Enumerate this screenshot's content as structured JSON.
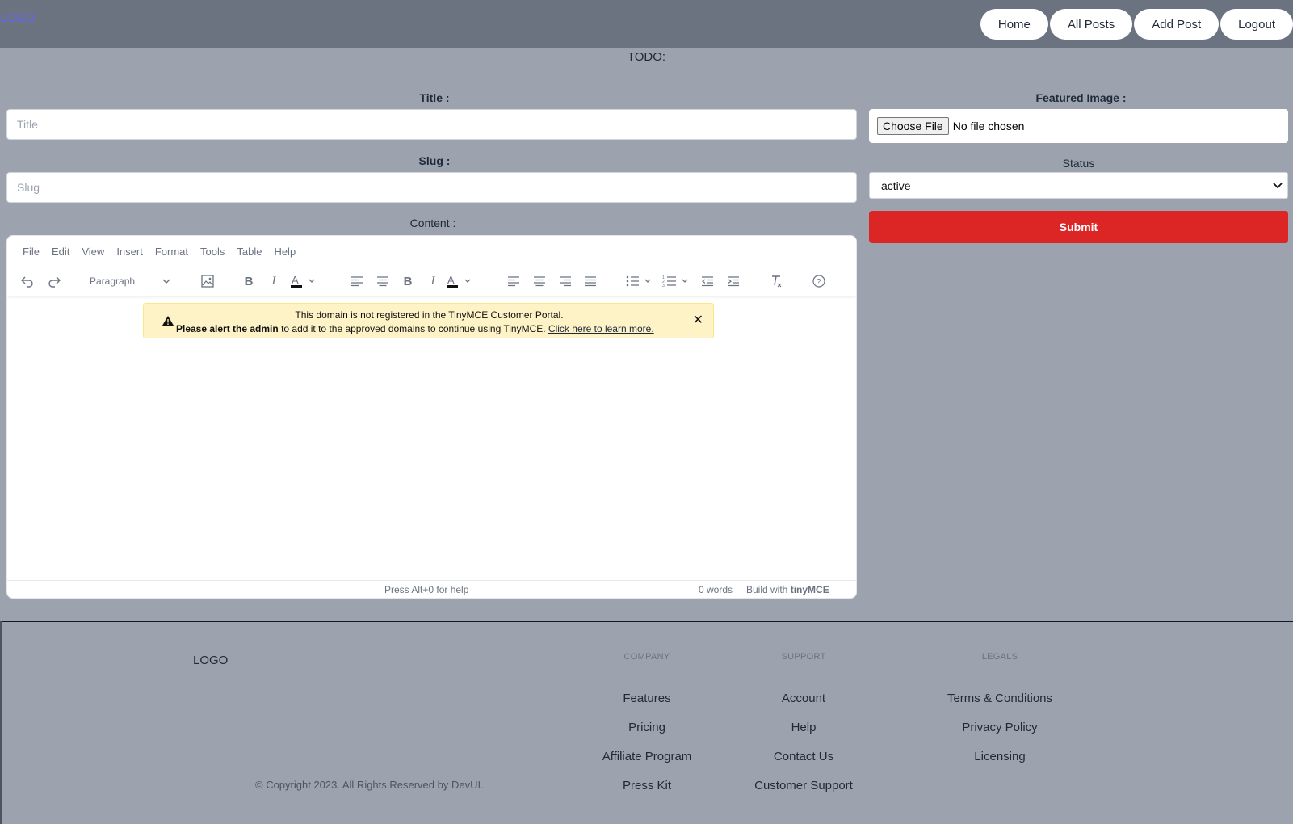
{
  "header": {
    "logo": "LOGO",
    "nav": [
      "Home",
      "All Posts",
      "Add Post",
      "Logout"
    ]
  },
  "todo": "TODO:",
  "form": {
    "title_label": "Title :",
    "title_placeholder": "Title",
    "slug_label": "Slug :",
    "slug_placeholder": "Slug",
    "content_label": "Content :",
    "featured_label": "Featured Image :",
    "file_button": "Choose File",
    "file_status": "No file chosen",
    "status_label": "Status",
    "status_value": "active",
    "submit": "Submit"
  },
  "editor": {
    "menu": [
      "File",
      "Edit",
      "View",
      "Insert",
      "Format",
      "Tools",
      "Table",
      "Help"
    ],
    "block_format": "Paragraph",
    "toolbar_icons": [
      "undo-icon",
      "redo-icon",
      "image-icon",
      "bold-icon",
      "italic-icon",
      "text-color-icon",
      "align-left-icon",
      "align-center-icon",
      "align-right-icon",
      "justify-icon",
      "bullet-list-icon",
      "numbered-list-icon",
      "outdent-icon",
      "indent-icon",
      "clear-format-icon",
      "help-icon"
    ],
    "notice_line1": "This domain is not registered in the TinyMCE Customer Portal.",
    "notice_bold": "Please alert the admin",
    "notice_rest": " to add it to the approved domains to continue using TinyMCE. ",
    "notice_link": "Click here to learn more.",
    "status_help": "Press Alt+0 for help",
    "status_words": "0 words",
    "status_build": "Build with",
    "status_brand": "tinyMCE"
  },
  "footer": {
    "logo": "LOGO",
    "company": {
      "heading": "COMPANY",
      "links": [
        "Features",
        "Pricing",
        "Affiliate Program",
        "Press Kit"
      ]
    },
    "support": {
      "heading": "SUPPORT",
      "links": [
        "Account",
        "Help",
        "Contact Us",
        "Customer Support"
      ]
    },
    "legals": {
      "heading": "LEGALS",
      "links": [
        "Terms & Conditions",
        "Privacy Policy",
        "Licensing"
      ]
    },
    "copyright": "© Copyright 2023. All Rights Reserved by DevUI."
  },
  "colors": {
    "page_bg": "#9ca3af",
    "header_bg": "#6b7280",
    "submit_bg": "#dc2626",
    "notice_bg": "#fef3c7",
    "logo_color": "#6366f1"
  }
}
